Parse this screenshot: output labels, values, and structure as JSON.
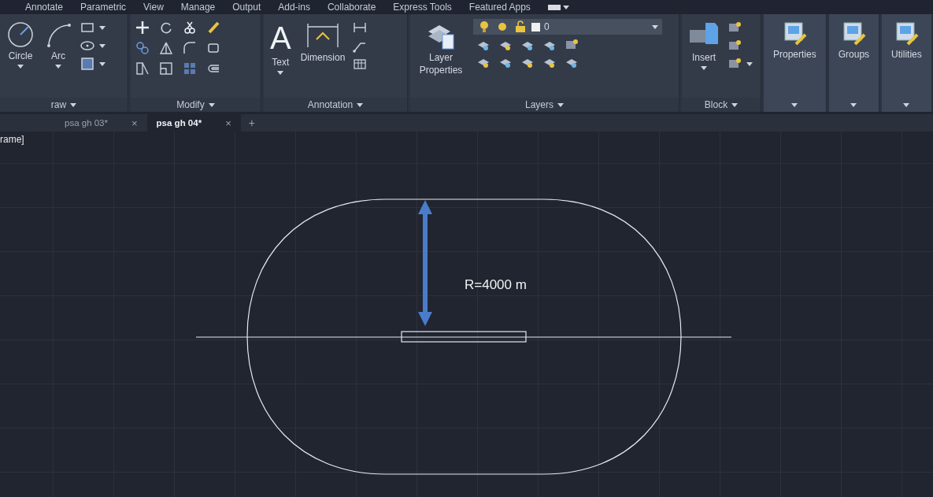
{
  "menu_tabs": [
    {
      "label": "Annotate"
    },
    {
      "label": "Parametric"
    },
    {
      "label": "View"
    },
    {
      "label": "Manage"
    },
    {
      "label": "Output"
    },
    {
      "label": "Add-ins"
    },
    {
      "label": "Collaborate"
    },
    {
      "label": "Express Tools"
    },
    {
      "label": "Featured Apps"
    }
  ],
  "ribbon": {
    "panels": [
      {
        "kind": "draw",
        "title": "raw",
        "large_tools": [
          {
            "label": "Circle"
          },
          {
            "label": "Arc"
          }
        ]
      },
      {
        "kind": "modify",
        "title": "Modify"
      },
      {
        "kind": "annotation",
        "title": "Annotation",
        "large_tools": [
          {
            "label": "Text",
            "glyph": "A"
          },
          {
            "label": "Dimension"
          }
        ]
      },
      {
        "kind": "layers",
        "title": "Layers",
        "large_tools": [
          {
            "label": "Layer Properties"
          }
        ],
        "layer_field": {
          "value": "0"
        }
      },
      {
        "kind": "block",
        "title": "Block",
        "large_tools": [
          {
            "label": "Insert"
          }
        ]
      },
      {
        "kind": "single",
        "large_tools": [
          {
            "label": "Properties"
          }
        ]
      },
      {
        "kind": "single",
        "large_tools": [
          {
            "label": "Groups"
          }
        ]
      },
      {
        "kind": "single",
        "large_tools": [
          {
            "label": "Utilities"
          }
        ]
      }
    ]
  },
  "document_tabs": [
    {
      "label": "psa gh 03*",
      "close": "×",
      "selected": false
    },
    {
      "label": "psa gh 04*",
      "close": "×",
      "selected": true
    }
  ],
  "new_tab": "+",
  "viewport_label": "rame]",
  "drawing": {
    "dimension_text": "R=4000 m"
  }
}
